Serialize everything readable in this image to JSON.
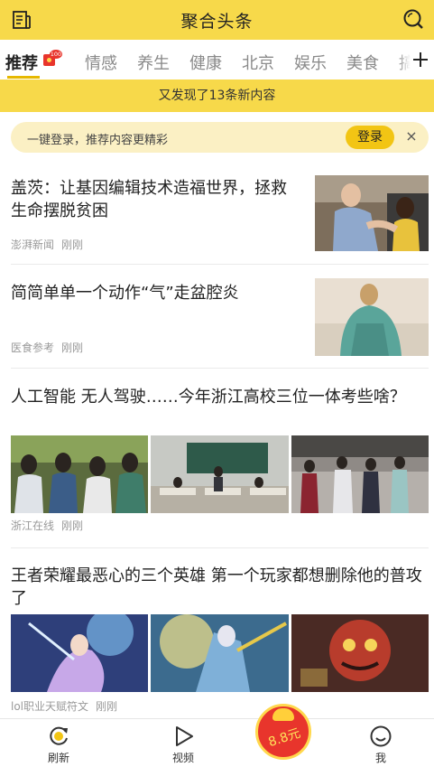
{
  "header": {
    "title": "聚合头条"
  },
  "tabs": [
    {
      "label": "推荐",
      "active": true,
      "badge": "100"
    },
    {
      "label": "情感"
    },
    {
      "label": "养生"
    },
    {
      "label": "健康"
    },
    {
      "label": "北京"
    },
    {
      "label": "娱乐"
    },
    {
      "label": "美食"
    },
    {
      "label": "搞"
    }
  ],
  "notice": "又发现了13条新内容",
  "login_prompt": {
    "text": "一键登录，推荐内容更精彩",
    "button": "登录",
    "close": "×"
  },
  "articles": [
    {
      "title": "盖茨：让基因编辑技术造福世界，拯救生命摆脱贫困",
      "source": "澎湃新闻",
      "time": "刚刚",
      "image": "bill-gates-with-child-photo"
    },
    {
      "title": "简简单单一个动作“气”走盆腔炎",
      "source": "医食参考",
      "time": "刚刚",
      "image": "woman-with-scarf-photo"
    },
    {
      "title": "人工智能 无人驾驶……今年浙江高校三位一体考些啥？",
      "source": "浙江在线",
      "time": "刚刚",
      "images": [
        "students-crowd-photo",
        "classroom-exam-photo",
        "campus-stairs-photo"
      ]
    },
    {
      "title": "王者荣耀最恶心的三个英雄 第一个玩家都想删除他的普攻了",
      "source": "lol职业天赋符文",
      "time": "刚刚",
      "images": [
        "game-hero-1-art",
        "game-hero-2-art",
        "game-hero-3-art"
      ]
    }
  ],
  "bottom_nav": [
    {
      "label": "刷新",
      "icon": "refresh-icon"
    },
    {
      "label": "视频",
      "icon": "video-play-icon"
    },
    {
      "label": "我",
      "icon": "profile-face-icon"
    }
  ],
  "red_packet": {
    "amount": "8.8元"
  },
  "colors": {
    "brand_yellow": "#f7d94a",
    "accent": "#f2c514",
    "red_packet": "#e8352c"
  }
}
